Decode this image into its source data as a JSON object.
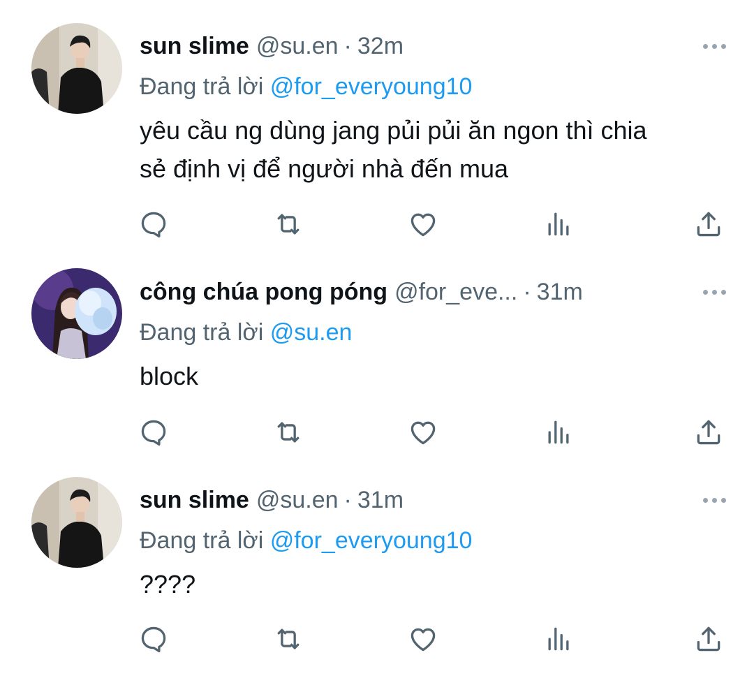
{
  "tweets": [
    {
      "name": "sun slime",
      "handle": "@su.en",
      "separator": "·",
      "time": "32m",
      "reply_prefix": "Đang trả lời",
      "reply_to": "@for_everyoung10",
      "text_line1": "yêu cầu ng dùng jang pủi pủi ăn ngon thì chia",
      "text_line2": "sẻ định vị để người nhà đến mua",
      "avatar": "avatar-man-in-black"
    },
    {
      "name": "công chúa pong póng",
      "handle": "@for_eve...",
      "separator": "·",
      "time": "31m",
      "reply_prefix": "Đang trả lời",
      "reply_to": "@su.en",
      "text_line1": "block",
      "avatar": "avatar-woman-blue-flowers"
    },
    {
      "name": "sun slime",
      "handle": "@su.en",
      "separator": "·",
      "time": "31m",
      "reply_prefix": "Đang trả lời",
      "reply_to": "@for_everyoung10",
      "text_line1": "????",
      "avatar": "avatar-man-in-black"
    }
  ],
  "icons": {
    "reply": "reply-icon",
    "retweet": "retweet-icon",
    "like": "like-icon",
    "views": "views-icon",
    "share": "share-icon",
    "more": "more-icon"
  },
  "colors": {
    "text": "#0f1419",
    "secondary": "#536471",
    "mention": "#1d9bf0",
    "icon": "#536471"
  }
}
